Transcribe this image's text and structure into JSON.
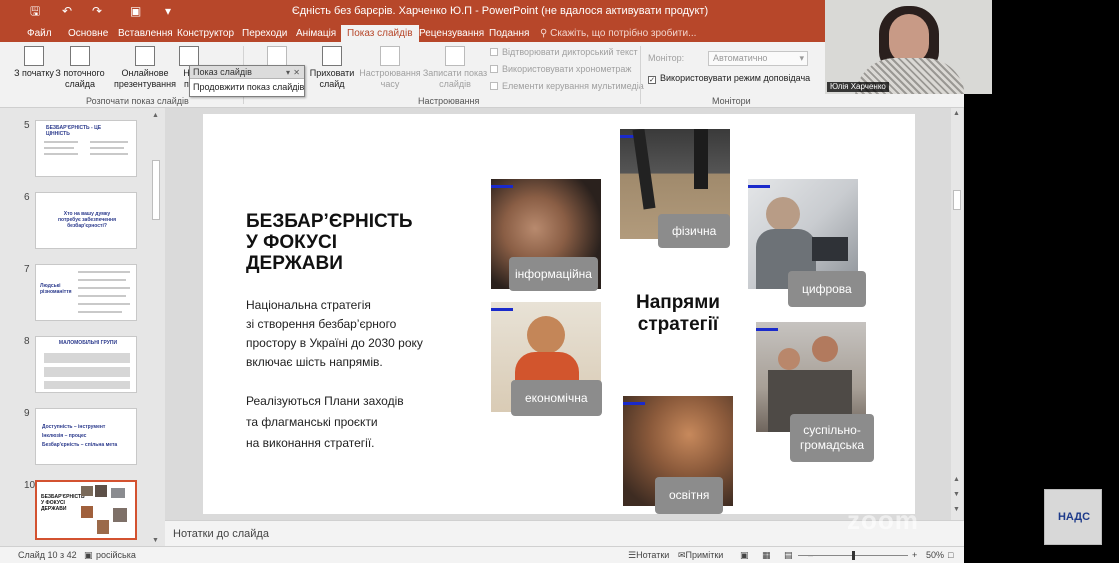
{
  "window": {
    "title": "Єдність без барєрів. Харченко Ю.П - PowerPoint (не вдалося активувати продукт)"
  },
  "tabs": [
    "Файл",
    "Основне",
    "Вставлення",
    "Конструктор",
    "Переходи",
    "Анімація",
    "Показ слайдів",
    "Рецензування",
    "Подання"
  ],
  "tell_me": "Скажіть, що потрібно зробити...",
  "ribbon": {
    "buttons": {
      "from_start": "З початку",
      "from_current": "З поточного слайда",
      "online": "Онлайнове презентування",
      "custom_partial": "На по",
      "hide_slide": "Приховати слайд",
      "rehearse": "Настроювання часу",
      "record": "Записати показ слайдів"
    },
    "checkboxes": {
      "narration": "Відтворювати дикторський текст",
      "timings": "Використовувати хронометраж",
      "media_controls": "Елементи керування мультимедіа",
      "presenter_view": "Використовувати режим доповідача"
    },
    "monitor_label": "Монітор:",
    "monitor_value": "Автоматично",
    "groups": {
      "start": "Розпочати показ слайдів",
      "setup": "Настроювання",
      "monitors": "Монітори"
    }
  },
  "floating_toolbar": {
    "title": "Показ слайдів",
    "command": "Продовжити показ слайдів"
  },
  "thumbnails": [
    {
      "num": "5",
      "title": "БЕЗБАР'ЄРНІСТЬ - ЦЕ ЦІННІСТЬ"
    },
    {
      "num": "6",
      "title": "Хто на вашу думку потребує забезпечення безбар'єрності?"
    },
    {
      "num": "7",
      "title": "Людські різноманіття"
    },
    {
      "num": "8",
      "title": "МАЛОМОБІЛЬНІ ГРУПИ"
    },
    {
      "num": "9",
      "title": "Доступність – інструмент\nІнклюзія – процес\nБезбар'єрність – спільна мета"
    },
    {
      "num": "10",
      "title": "БЕЗБАР'ЄРНІСТЬ У ФОКУСІ ДЕРЖАВИ"
    }
  ],
  "slide": {
    "title_lines": [
      "БЕЗБАР’ЄРНІСТЬ",
      "У ФОКУСІ",
      "ДЕРЖАВИ"
    ],
    "body1": [
      "Національна стратегія",
      "зі створення безбар’єрного",
      "простору в Україні до 2030 року",
      "включає шість напрямів."
    ],
    "body2": [
      "Реалізуються Плани заходів",
      "та флагманські проєкти",
      "на виконання стратегії."
    ],
    "center_title": [
      "Напрями",
      "стратегії"
    ],
    "labels": {
      "physical": "фізична",
      "info": "інформаційна",
      "digital": "цифрова",
      "economic": "економічна",
      "social": [
        "суспільно-",
        "громадська"
      ],
      "education": "освітня"
    }
  },
  "notes_placeholder": "Нотатки до слайда",
  "status": {
    "slide_info": "Слайд 10 з 42",
    "language": "російська",
    "notes": "Нотатки",
    "comments": "Примітки",
    "zoom": "50%"
  },
  "overlay": {
    "zoom_watermark": "zoom",
    "participant_name": "Юлія Харченко",
    "logo_text": "НАДС"
  },
  "colors": {
    "ppt_accent": "#b7472a",
    "slide_label_bg": "#8c8c8c",
    "photo_marker": "#1a2acb"
  }
}
